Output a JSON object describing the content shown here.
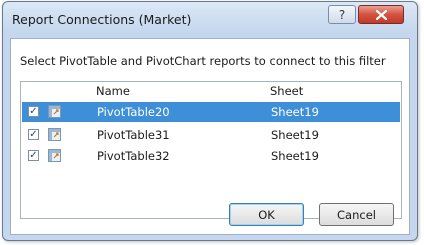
{
  "dialog": {
    "title": "Report Connections (Market)",
    "help_glyph": "?",
    "close_glyph": "x"
  },
  "instruction": "Select PivotTable and PivotChart reports to connect to this filter",
  "list": {
    "columns": [
      "Name",
      "Sheet"
    ],
    "rows": [
      {
        "checked": true,
        "check_glyph": "✓",
        "name": "PivotTable20",
        "sheet": "Sheet19",
        "selected": true
      },
      {
        "checked": true,
        "check_glyph": "✓",
        "name": "PivotTable31",
        "sheet": "Sheet19",
        "selected": false
      },
      {
        "checked": true,
        "check_glyph": "✓",
        "name": "PivotTable32",
        "sheet": "Sheet19",
        "selected": false
      }
    ]
  },
  "buttons": {
    "ok": "OK",
    "cancel": "Cancel"
  },
  "colors": {
    "selection": "#3f8fd8",
    "close": "#c0392b"
  }
}
